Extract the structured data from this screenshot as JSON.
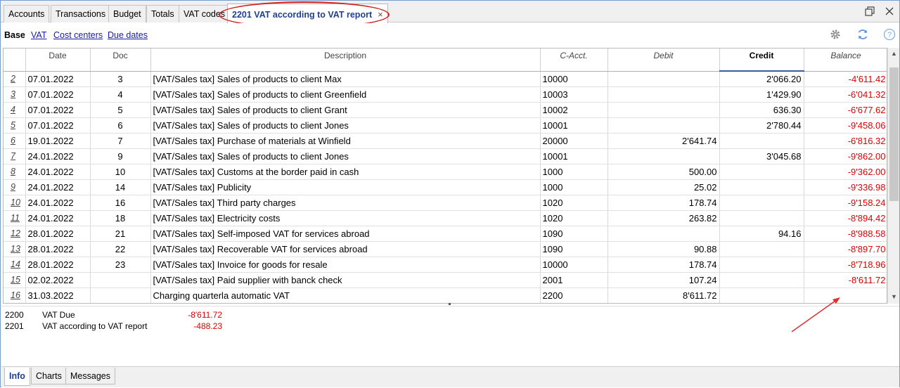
{
  "tabs": [
    {
      "label": "Accounts"
    },
    {
      "label": "Transactions"
    },
    {
      "label": "Budget"
    },
    {
      "label": "Totals"
    },
    {
      "label": "VAT codes"
    },
    {
      "label": "2201 VAT according to VAT report",
      "active": true,
      "close": "×"
    }
  ],
  "subnav": {
    "items": [
      {
        "label": "Base",
        "current": true
      },
      {
        "label": "VAT"
      },
      {
        "label": "Cost centers"
      },
      {
        "label": "Due dates"
      }
    ],
    "icons": [
      "gear-icon",
      "refresh-icon",
      "help-icon"
    ]
  },
  "table": {
    "columns": [
      "",
      "Date",
      "Doc",
      "Description",
      "C-Acct.",
      "Debit",
      "Credit",
      "Balance"
    ],
    "rows": [
      {
        "n": "2",
        "date": "07.01.2022",
        "doc": "3",
        "desc": "[VAT/Sales tax] Sales of products to client Max",
        "acct": "10000",
        "debit": "",
        "credit": "2'066.20",
        "balance": "-4'611.42"
      },
      {
        "n": "3",
        "date": "07.01.2022",
        "doc": "4",
        "desc": "[VAT/Sales tax] Sales of products to client Greenfield",
        "acct": "10003",
        "debit": "",
        "credit": "1'429.90",
        "balance": "-6'041.32"
      },
      {
        "n": "4",
        "date": "07.01.2022",
        "doc": "5",
        "desc": "[VAT/Sales tax] Sales of products to client Grant",
        "acct": "10002",
        "debit": "",
        "credit": "636.30",
        "balance": "-6'677.62"
      },
      {
        "n": "5",
        "date": "07.01.2022",
        "doc": "6",
        "desc": "[VAT/Sales tax] Sales of products to client Jones",
        "acct": "10001",
        "debit": "",
        "credit": "2'780.44",
        "balance": "-9'458.06"
      },
      {
        "n": "6",
        "date": "19.01.2022",
        "doc": "7",
        "desc": "[VAT/Sales tax] Purchase of materials at Winfield",
        "acct": "20000",
        "debit": "2'641.74",
        "credit": "",
        "balance": "-6'816.32"
      },
      {
        "n": "7",
        "date": "24.01.2022",
        "doc": "9",
        "desc": "[VAT/Sales tax] Sales of products to client Jones",
        "acct": "10001",
        "debit": "",
        "credit": "3'045.68",
        "balance": "-9'862.00"
      },
      {
        "n": "8",
        "date": "24.01.2022",
        "doc": "10",
        "desc": "[VAT/Sales tax] Customs at the border paid in cash",
        "acct": "1000",
        "debit": "500.00",
        "credit": "",
        "balance": "-9'362.00"
      },
      {
        "n": "9",
        "date": "24.01.2022",
        "doc": "14",
        "desc": "[VAT/Sales tax] Publicity",
        "acct": "1000",
        "debit": "25.02",
        "credit": "",
        "balance": "-9'336.98"
      },
      {
        "n": "10",
        "date": "24.01.2022",
        "doc": "16",
        "desc": "[VAT/Sales tax] Third party charges",
        "acct": "1020",
        "debit": "178.74",
        "credit": "",
        "balance": "-9'158.24"
      },
      {
        "n": "11",
        "date": "24.01.2022",
        "doc": "18",
        "desc": "[VAT/Sales tax] Electricity costs",
        "acct": "1020",
        "debit": "263.82",
        "credit": "",
        "balance": "-8'894.42"
      },
      {
        "n": "12",
        "date": "28.01.2022",
        "doc": "21",
        "desc": "[VAT/Sales tax] Self-imposed VAT for services abroad",
        "acct": "1090",
        "debit": "",
        "credit": "94.16",
        "balance": "-8'988.58"
      },
      {
        "n": "13",
        "date": "28.01.2022",
        "doc": "22",
        "desc": "[VAT/Sales tax] Recoverable VAT for services abroad",
        "acct": "1090",
        "debit": "90.88",
        "credit": "",
        "balance": "-8'897.70"
      },
      {
        "n": "14",
        "date": "28.01.2022",
        "doc": "23",
        "desc": "[VAT/Sales tax] Invoice for goods for resale",
        "acct": "10000",
        "debit": "178.74",
        "credit": "",
        "balance": "-8'718.96"
      },
      {
        "n": "15",
        "date": "02.02.2022",
        "doc": "",
        "desc": "[VAT/Sales tax] Paid supplier with banck check",
        "acct": "2001",
        "debit": "107.24",
        "credit": "",
        "balance": "-8'611.72"
      },
      {
        "n": "16",
        "date": "31.03.2022",
        "doc": "",
        "desc": "Charging quarterla automatic VAT",
        "acct": "2200",
        "debit": "8'611.72",
        "credit": "",
        "balance": ""
      }
    ]
  },
  "info": [
    {
      "acct": "2200",
      "desc": "VAT Due",
      "amount": "-8'611.72"
    },
    {
      "acct": "2201",
      "desc": "VAT according to VAT report",
      "amount": "-488.23"
    }
  ],
  "bottom_tabs": [
    {
      "label": "Info",
      "active": true
    },
    {
      "label": "Charts"
    },
    {
      "label": "Messages"
    }
  ],
  "colors": {
    "negative": "#e00000",
    "annotation": "#d42020",
    "active_tab_text": "#1f3f8f"
  }
}
